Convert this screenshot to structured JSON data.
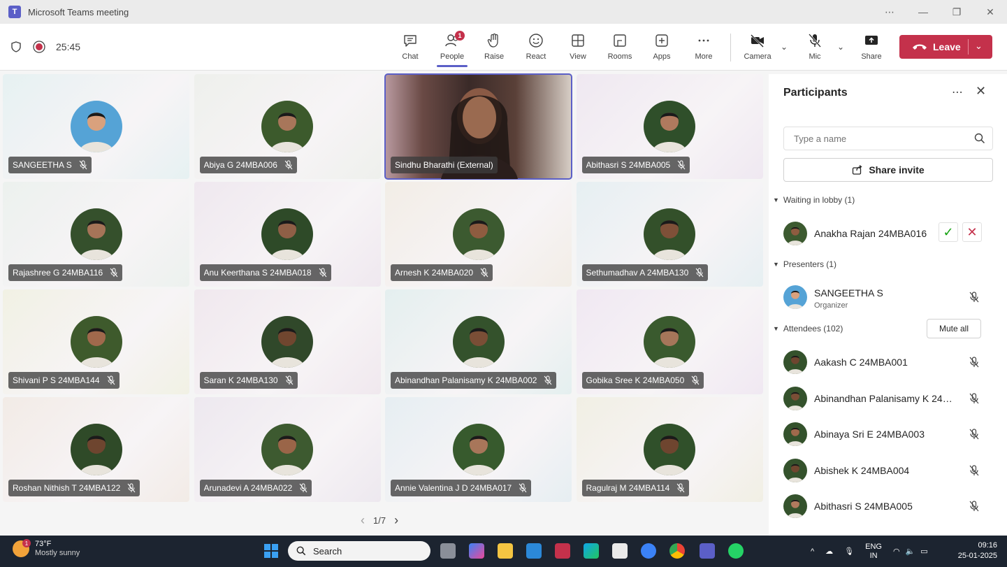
{
  "window": {
    "title": "Microsoft Teams meeting",
    "controls": [
      "⋯",
      "—",
      "❐",
      "✕"
    ]
  },
  "meeting": {
    "timer": "25:45"
  },
  "toolbar": {
    "chat": "Chat",
    "people": "People",
    "people_badge": "1",
    "raise": "Raise",
    "react": "React",
    "view": "View",
    "rooms": "Rooms",
    "apps": "Apps",
    "more": "More",
    "camera": "Camera",
    "mic": "Mic",
    "share": "Share",
    "leave": "Leave"
  },
  "tiles": [
    {
      "name": "SANGEETHA S",
      "bg": "#e6f1f2",
      "av": "#55a3d6",
      "skin": "#d9a17d"
    },
    {
      "name": "Abiya G 24MBA006",
      "bg": "#eef0ec",
      "av": "#3c5a2c",
      "skin": "#a8765a"
    },
    {
      "name": "Sindhu Bharathi (External)",
      "bg": "#6a4a45",
      "video": true
    },
    {
      "name": "Abithasri S 24MBA005",
      "bg": "#efe8f1",
      "av": "#2f4f2a",
      "skin": "#b07a5e"
    },
    {
      "name": "Rajashree G 24MBA116",
      "bg": "#ecf1ee",
      "av": "#35502c",
      "skin": "#a67458"
    },
    {
      "name": "Anu Keerthana S 24MBA018",
      "bg": "#efe8ef",
      "av": "#2e4a28",
      "skin": "#8f5f46"
    },
    {
      "name": "Arnesh K 24MBA020",
      "bg": "#f2ede6",
      "av": "#3c5a30",
      "skin": "#8e5c40"
    },
    {
      "name": "Sethumadhav A 24MBA130",
      "bg": "#e6eff2",
      "av": "#33502a",
      "skin": "#7e5038"
    },
    {
      "name": "Shivani P S 24MBA144",
      "bg": "#f1f1e4",
      "av": "#3e5a2c",
      "skin": "#a0694c"
    },
    {
      "name": "Saran K 24MBA130",
      "bg": "#f0e8ee",
      "av": "#30482a",
      "skin": "#70462f"
    },
    {
      "name": "Abinandhan Palanisamy K 24MBA002",
      "bg": "#e4efef",
      "av": "#34522c",
      "skin": "#7a4e36"
    },
    {
      "name": "Gobika Sree K 24MBA050",
      "bg": "#f0e8f2",
      "av": "#3a5a2e",
      "skin": "#a6765a"
    },
    {
      "name": "Roshan Nithish T 24MBA122",
      "bg": "#f2ebe6",
      "av": "#2f4a28",
      "skin": "#6e452f"
    },
    {
      "name": "Arunadevi A 24MBA022",
      "bg": "#ede8ef",
      "av": "#3d5a30",
      "skin": "#9a6548"
    },
    {
      "name": "Annie Valentina J D 24MBA017",
      "bg": "#e6eef2",
      "av": "#375a2d",
      "skin": "#a8765a"
    },
    {
      "name": "Ragulraj M 24MBA114",
      "bg": "#f1efe4",
      "av": "#30502a",
      "skin": "#6e452f"
    }
  ],
  "pager": {
    "text": "1/7",
    "prev": "‹",
    "next": "›"
  },
  "panel": {
    "title": "Participants",
    "search_placeholder": "Type a name",
    "share_invite": "Share invite",
    "lobby_header": "Waiting in lobby (1)",
    "lobby": [
      {
        "name": "Anakha Rajan 24MBA016",
        "skin": "#8e5c40"
      }
    ],
    "presenters_header": "Presenters (1)",
    "presenters": [
      {
        "name": "SANGEETHA S",
        "role": "Organizer",
        "skin": "#d9a17d",
        "av": "#55a3d6"
      }
    ],
    "attendees_header": "Attendees (102)",
    "mute_all": "Mute all",
    "attendees": [
      {
        "name": "Aakash C 24MBA001",
        "skin": "#6e452f"
      },
      {
        "name": "Abinandhan Palanisamy K 24MBA002",
        "skin": "#7a4e36"
      },
      {
        "name": "Abinaya Sri E 24MBA003",
        "skin": "#a0694c"
      },
      {
        "name": "Abishek K 24MBA004",
        "skin": "#70462f"
      },
      {
        "name": "Abithasri S 24MBA005",
        "skin": "#b07a5e"
      }
    ]
  },
  "taskbar": {
    "weather_temp": "73°F",
    "weather_desc": "Mostly sunny",
    "weather_badge": "1",
    "search": "Search",
    "lang": "ENG",
    "region": "IN",
    "time": "09:16",
    "date": "25-01-2025",
    "tray_up": "^"
  }
}
